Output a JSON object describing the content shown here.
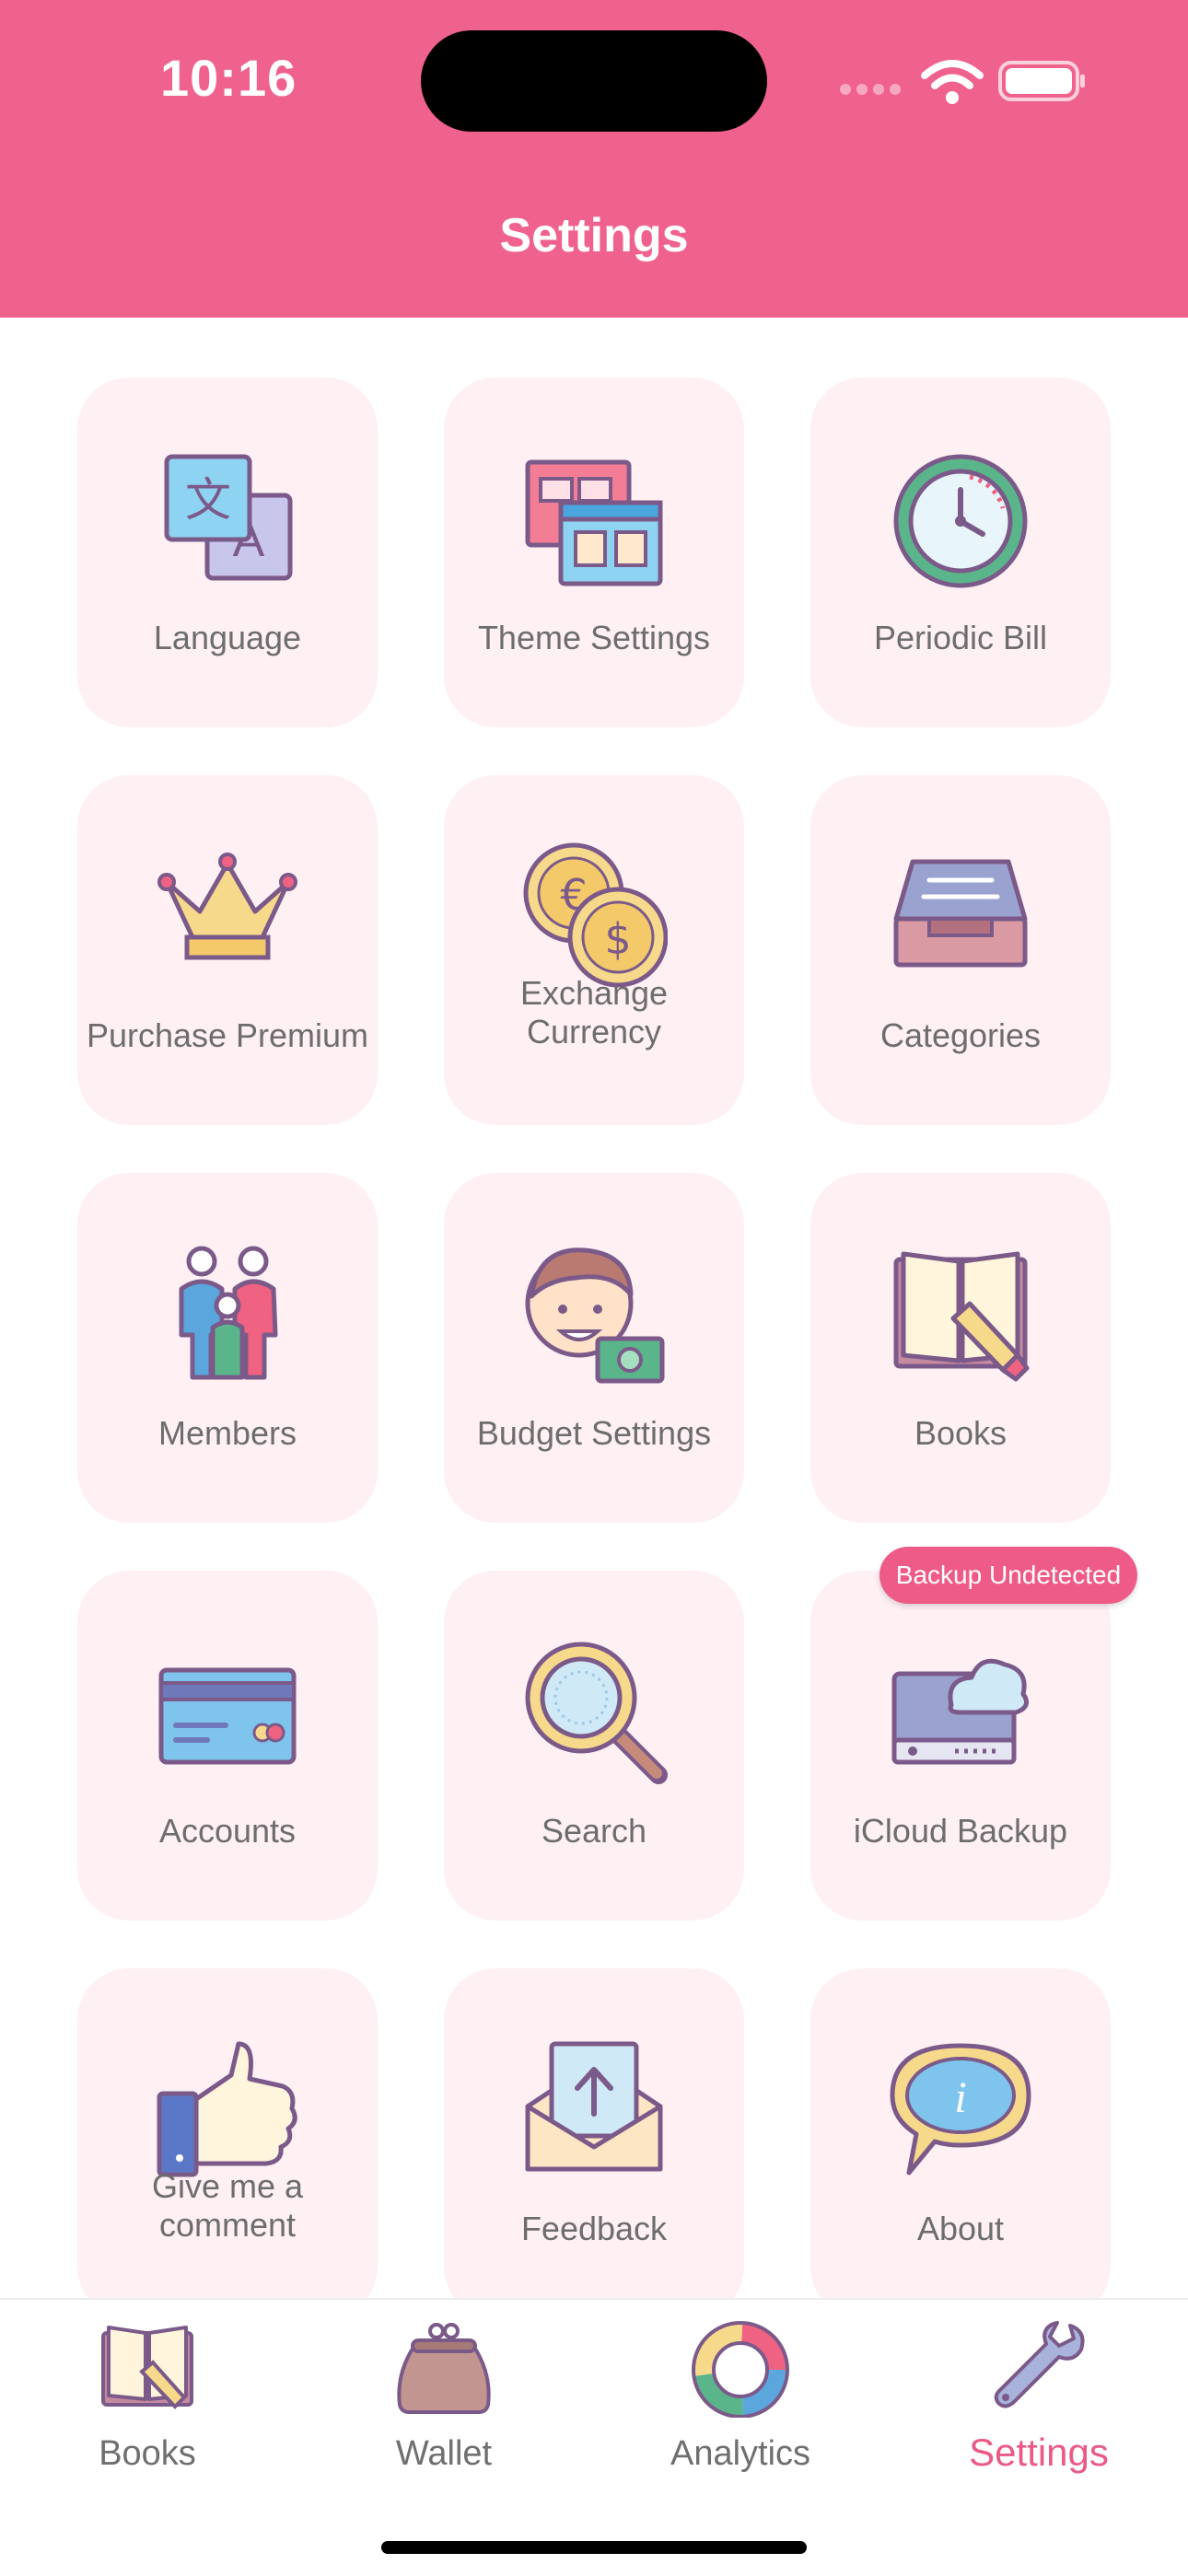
{
  "status": {
    "time": "10:16"
  },
  "header": {
    "title": "Settings"
  },
  "colors": {
    "accent": "#f0628e",
    "tile_bg": "#fff0f4",
    "badge": "#ee5b86",
    "active_tab": "#ea5a86"
  },
  "tiles": [
    {
      "label": "Language",
      "icon": "translate-icon"
    },
    {
      "label": "Theme Settings",
      "icon": "theme-windows-icon"
    },
    {
      "label": "Periodic Bill",
      "icon": "clock-icon"
    },
    {
      "label": "Purchase Premium",
      "icon": "crown-icon"
    },
    {
      "label": "Exchange\nCurrency",
      "label_line1": "Exchange",
      "label_line2": "Currency",
      "icon": "coins-icon"
    },
    {
      "label": "Categories",
      "icon": "inbox-tray-icon"
    },
    {
      "label": "Members",
      "icon": "family-icon"
    },
    {
      "label": "Budget Settings",
      "icon": "person-money-icon"
    },
    {
      "label": "Books",
      "icon": "book-pencil-icon"
    },
    {
      "label": "Accounts",
      "icon": "credit-card-icon"
    },
    {
      "label": "Search",
      "icon": "magnifier-icon"
    },
    {
      "label": "iCloud Backup",
      "icon": "cloud-drive-icon"
    },
    {
      "label": "Give me a\ncomment",
      "label_line1": "Give me a",
      "label_line2": "comment",
      "icon": "thumbs-up-icon"
    },
    {
      "label": "Feedback",
      "icon": "envelope-upload-icon"
    },
    {
      "label": "About",
      "icon": "info-bubble-icon"
    }
  ],
  "backup_badge": "Backup Undetected",
  "tabbar": [
    {
      "label": "Books",
      "icon": "book-icon",
      "active": false
    },
    {
      "label": "Wallet",
      "icon": "purse-icon",
      "active": false
    },
    {
      "label": "Analytics",
      "icon": "donut-chart-icon",
      "active": false
    },
    {
      "label": "Settings",
      "icon": "wrench-icon",
      "active": true
    }
  ]
}
